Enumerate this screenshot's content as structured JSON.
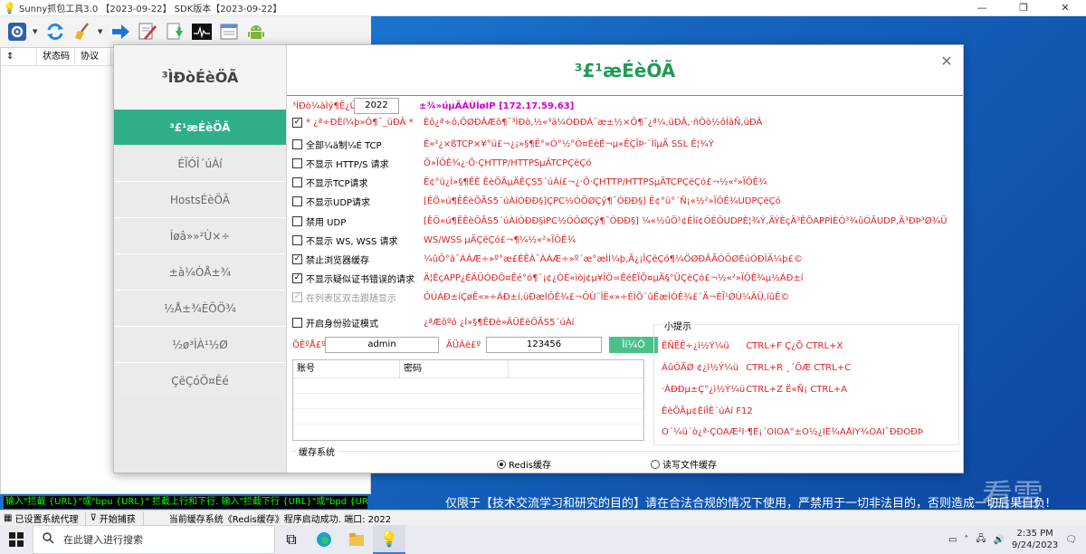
{
  "window": {
    "title": "Sunny抓包工具3.0 【2023-09-22】     SDK版本【2023-09-22】",
    "controls": [
      "—",
      "❐",
      "✕"
    ]
  },
  "toolbar": {
    "icons": [
      "gear-icon",
      "refresh-icon",
      "broom-icon",
      "arrow-right-icon",
      "edit-icon",
      "download-icon",
      "terminal-icon",
      "notes-icon",
      "android-icon"
    ]
  },
  "grid": {
    "columns": [
      "⇕",
      "状态码",
      "协议"
    ]
  },
  "log": {
    "text": "输入\"拦截 {URL}\"或\"bpu {URL}\" 拦截上行和下行. 输入\"拦截下行 {URL}\"或\"bpd {URL}\"拦截下行."
  },
  "status": {
    "proxy": "已设置系统代理",
    "capture": "开始捕获",
    "message": "当前缓存系统《Redis缓存》程序启动成功. 端口: 2022"
  },
  "dialog": {
    "side_title": "³ÌÐòÉèÖÃ",
    "nav": [
      "³£¹æÉèÖÃ",
      "ÉÏÓÎ´úÀí",
      "HostsÉèÖÃ",
      "Íøâ»»²Ù×÷",
      "±à¼­ÒÅ±¾",
      "½Å±¾ÈÕÖ¾",
      "½ø³ÌÀ¹½Ø",
      "ÇëÇóÖ¤Êé"
    ],
    "active_nav": 0,
    "content_title": "³£¹æÉèÖÃ",
    "close": "✕",
    "port_label": "³ÌÐò¼àÌý¶Ë¿Ú£º",
    "port_value": "2022",
    "ip_text": "±¾»úµÄÁÙÍøIP [172.17.59.63]",
    "options": [
      {
        "checked": true,
        "label": "* ¿ª÷ÐÈí¼þ»Ô¶¯_üÐÂ *",
        "desc": "Èô¿ª÷ô,ÖØÐÂÆô¶¯³ÌÐò,½«³ä¼ÓÐÐÀ¨æ±½×Ô¶¯¿ª¼,üÐÂ,·ñÔò½ôÍäÑ,üÐÂ",
        "disabled": false
      },
      {
        "checked": false,
        "label": "全部¼ä制¼É TCP",
        "desc": "È«²¿×ßTCP×¥°ü£¬¿¡»§¶Ë°»Ó°½°Ò¤ÉèÉ¬µ«ÊÇÎÞ·¨ÌîµÄ SSL Ê¦¾Ý",
        "disabled": false
      },
      {
        "checked": false,
        "label": "不显示 HTTP/S 请求",
        "desc": "Ö»ÏÔÊ¾¿·Ö·ÇHTTP/HTTPSµÄTCPÇëÇó",
        "disabled": false
      },
      {
        "checked": false,
        "label": "不显示TCP请求",
        "desc": "Ë¢°ü¿Ì»§¶ËÊ ÊèÖÃµÄÊÇS5´úÀí£¬¿·Ö·ÇHTTP/HTTPSµÄTCPÇëÇó£¬½«²»ÏÔÊ¾",
        "disabled": false
      },
      {
        "checked": false,
        "label": "不显示UDP请求",
        "desc": "[ÊÖ»ú¶ËÊèÖÃS5´úÀíÓÐÐ§]ÇPC½ÓÔØÇý¶¯ÓÐÐ§] Ë¢°ü°´Ñ¡«½²»ÏÔÊ¾UDPÇëÇó",
        "disabled": false
      },
      {
        "checked": false,
        "label": "禁用 UDP",
        "desc": "[ÊÖ»ú¶ËÊèÖÃS5´úÀíÓÐÐ§ìPC½ÓÔØÇý¶¯ÓÐÐ§] ¼«½ûÖ¹¢ÉÌí¢ÓÈÔUDPÈ¦¾Ý,ÄÝÈçÄ³ÊÖAPPÌÈÓ³¾ûÓÃUDP,Ä³ÐÞ³Ø¾Ü",
        "disabled": false
      },
      {
        "checked": false,
        "label": "不显示 WS, WSS 请求",
        "desc": "WS/WSS µÄÇëÇó£¬¶¼½«²»ÏÔÊ¾",
        "disabled": false
      },
      {
        "checked": true,
        "label": "禁止浏览器缓存",
        "desc": "¼ûÔ°ä¯ÀÀÆ÷»º°æ£ÈÊÀ¯ÀÀÆ÷»º´æ°æÌÍ¼þ,Ã¿¡ÎÇëÇó¶¼ÖØÐÂÃÓÔØÉúÓÐÎÄ¼þ£©",
        "disabled": false
      },
      {
        "checked": true,
        "label": "不显示疑似证书错误的请求",
        "desc": "Ä¦ÈçAPP¿ÉÄÜÓÐÖ¤Êé°ó¶¨¡¢¿ÒÈ«ìòj¢µ¥ÎÖ=ÊéÈÏÖ¤µÄ§°ÜÇëÇó£¬½«²»ÏÔÊ¾µ½ÁÐ±í",
        "disabled": false
      },
      {
        "checked": true,
        "label": "在列表区双击跟随显示",
        "desc": "ÔÚÁÐ±íÇøË«»÷ÁÐ±í,üÐæÌÔÊ¾£¬ÔÙ¨ÎË«»÷ÉÌÕ¨ûÊæÌÔÊ¾£¨Ä¬ÈÏ¹ØÙ¼ÄÜ,íûÊ©",
        "disabled": true
      }
    ],
    "auth_label": "开启身份验证模式",
    "auth_desc": "¿ªÆôºó ¿Í»§¶ËÐè»ÄÜÈëÖÃS5´úÀí",
    "user_label": "ÕÊºÅ£º",
    "user_value": "admin",
    "pass_label": "ÃÜÂë£º",
    "pass_value": "123456",
    "add_btn": "Ìí¼Ó",
    "acct_columns": [
      "账号",
      "密码"
    ],
    "tips_title": "小提示",
    "tips": [
      {
        "name": "ËÑËÊ÷¿ì½Ý¼ü",
        "keys": "CTRL+F    Ç¿Õ     CTRL+X"
      },
      {
        "name": "ÀûÓÃØ ¢¿ì½Ý¼ü",
        "keys": "CTRL+R    ¸´ÖÆ     CTRL+C"
      },
      {
        "name": "·ÀÐÐµ±Ç°¿ì½Ý¼ü",
        "keys": "CTRL+Z    Ë«Ñ¡     CTRL+A"
      },
      {
        "name": "ÊèÖÃµ¢ÈíÎÊ´úÀí F12",
        "keys": ""
      },
      {
        "name": "Ó´¼ü´ò¿ª·ÇÒÄÆ²Ï·¶È¡´ÒÏÖÃ°±Ó½¿ÏÊ¾ÃÅÌÝ¾ÖÃÌ¯ÐÐÔÐÞ",
        "keys": ""
      }
    ],
    "cache_title": "缓存系统",
    "cache_options": [
      {
        "label": "Redis缓存",
        "selected": true
      },
      {
        "label": "读写文件缓存",
        "selected": false
      }
    ]
  },
  "desktop": {
    "notice": "仅限于【技术交流学习和研究的目的】请在合法合规的情况下使用，严禁用于一切非法目的，否则造成一切后果自负!",
    "watermark": "看雪"
  },
  "taskbar": {
    "search_placeholder": "在此键入进行搜索",
    "time": "2:35 PM",
    "date": "9/24/2023"
  }
}
